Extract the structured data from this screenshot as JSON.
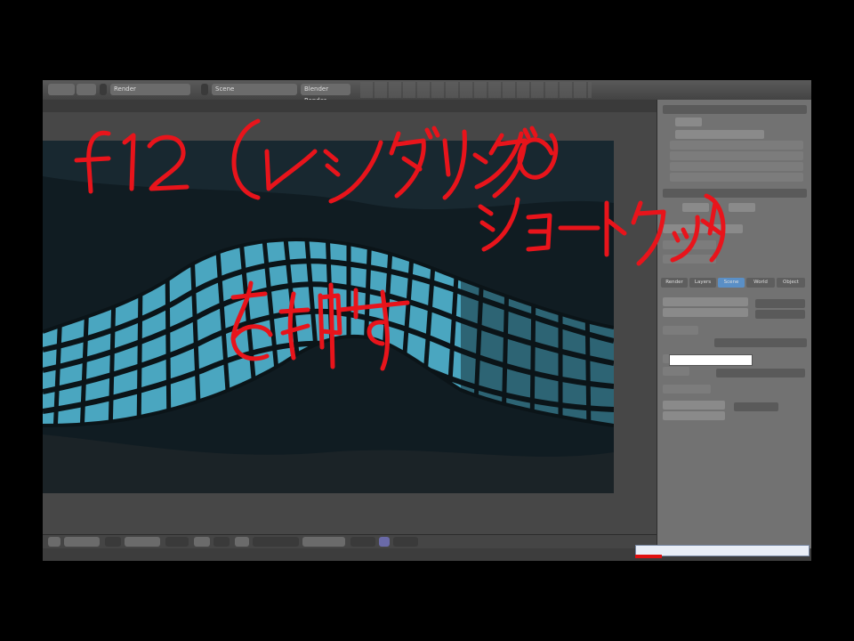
{
  "app": {
    "topbar_items": [
      "Render",
      "Scene",
      "Blender Render"
    ],
    "title": "Blender Render"
  },
  "properties": {
    "render_tabs": [
      "Render",
      "Layers",
      "Scene",
      "World",
      "Object"
    ],
    "active_tab": "World"
  },
  "annotation": {
    "line1": "f12 (レンダリングの",
    "line2": "ショートカット)",
    "line3": "を押す",
    "color": "#e8141b"
  },
  "render_colors": {
    "tile": "#4aa6c0",
    "mesh": "#0b1418",
    "background": "#0f1b21"
  }
}
